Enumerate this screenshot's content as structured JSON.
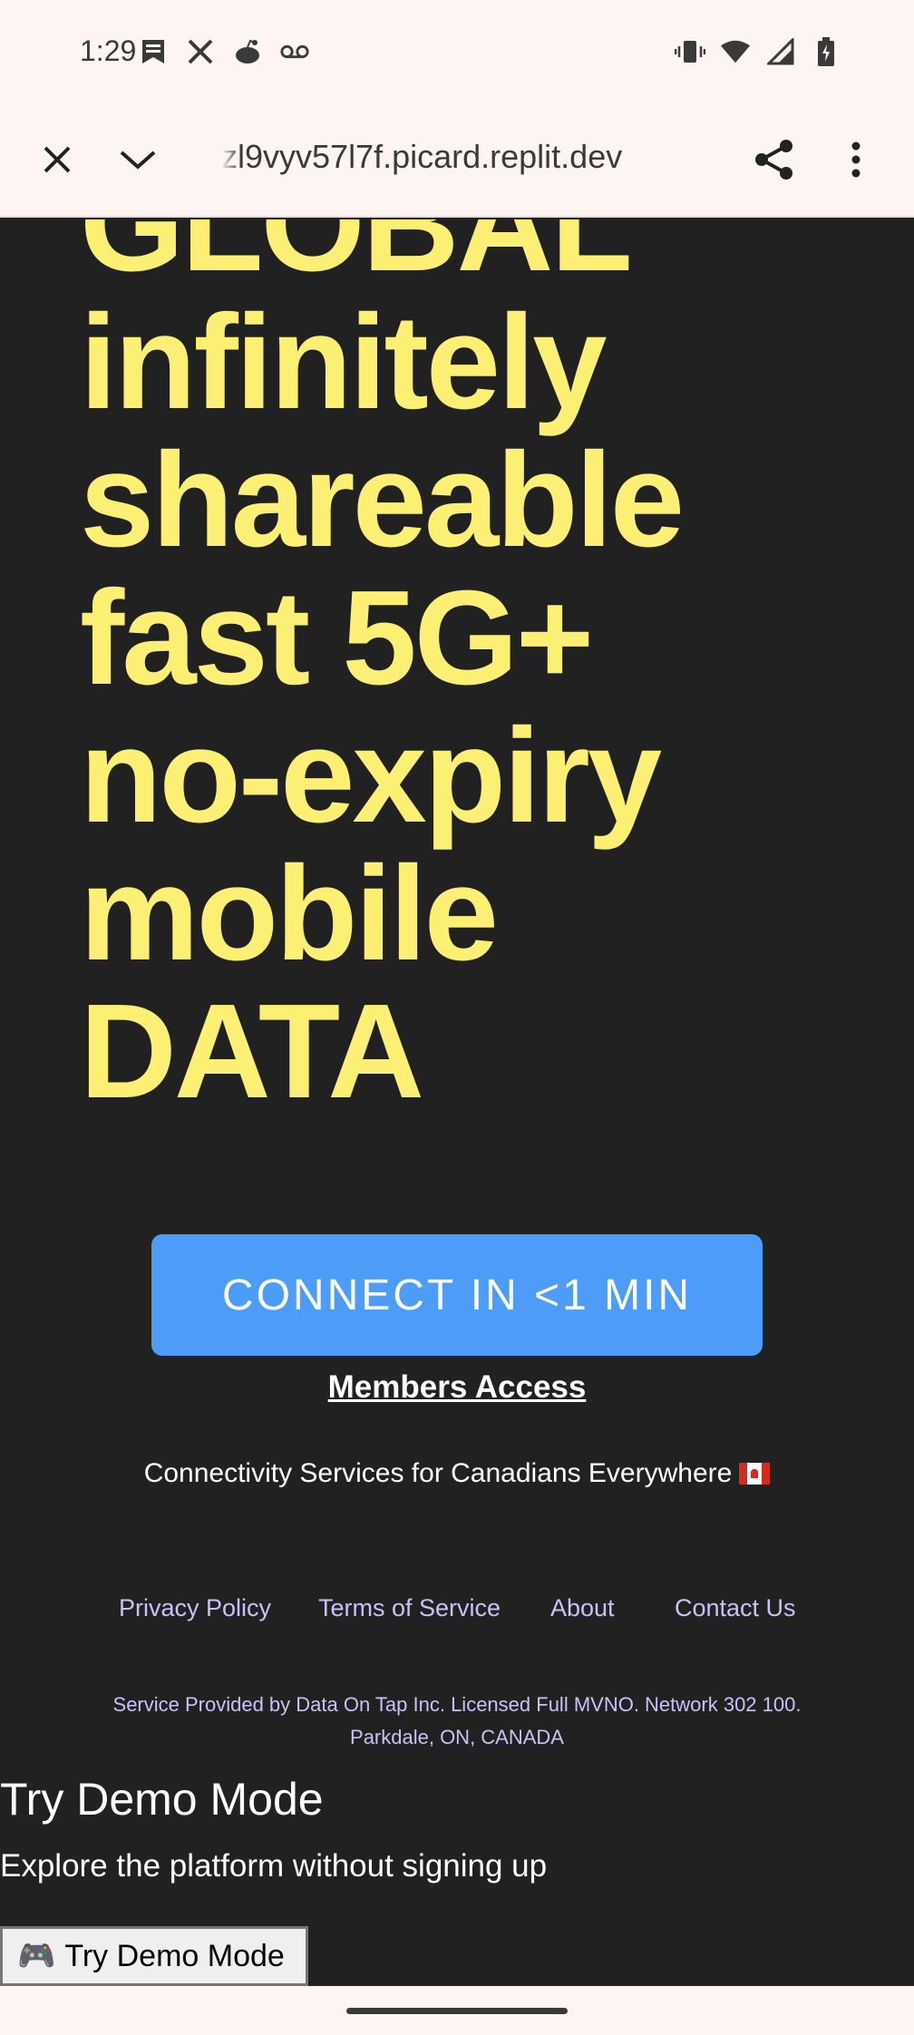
{
  "status_bar": {
    "time": "1:29",
    "left_icons": [
      "bookmark-notification-icon",
      "x-app-icon",
      "reddit-icon",
      "voicemail-icon"
    ],
    "right_icons": [
      "vibrate-icon",
      "wifi-icon",
      "cell-signal-icon",
      "battery-charging-icon"
    ]
  },
  "browser": {
    "url": "zl9vyv57l7f.picard.replit.dev",
    "close_icon": "close-icon",
    "collapse_icon": "chevron-down-icon",
    "share_icon": "share-icon",
    "menu_icon": "more-vert-icon"
  },
  "hero": {
    "lines": [
      "GLOBAL",
      "infinitely",
      "shareable",
      "fast 5G+",
      "no-expiry",
      "mobile",
      "DATA"
    ]
  },
  "cta": {
    "connect_label": "CONNECT IN <1 MIN",
    "members_label": "Members Access"
  },
  "tagline": "Connectivity Services for Canadians Everywhere",
  "footer": {
    "links": [
      "Privacy Policy",
      "Terms of Service",
      "About",
      "Contact Us"
    ],
    "legal_line1": "Service Provided by Data On Tap Inc. Licensed Full MVNO. Network 302 100.",
    "legal_line2": "Parkdale, ON, CANADA"
  },
  "demo": {
    "title": "Try Demo Mode",
    "subtitle": "Explore the platform without signing up",
    "button_label": "Try Demo Mode",
    "button_icon": "🎮"
  },
  "colors": {
    "background": "#212121",
    "hero_text": "#fbf074",
    "cta": "#4c9cf8",
    "link": "#c7c3f7",
    "chrome": "#fdf5f2"
  }
}
